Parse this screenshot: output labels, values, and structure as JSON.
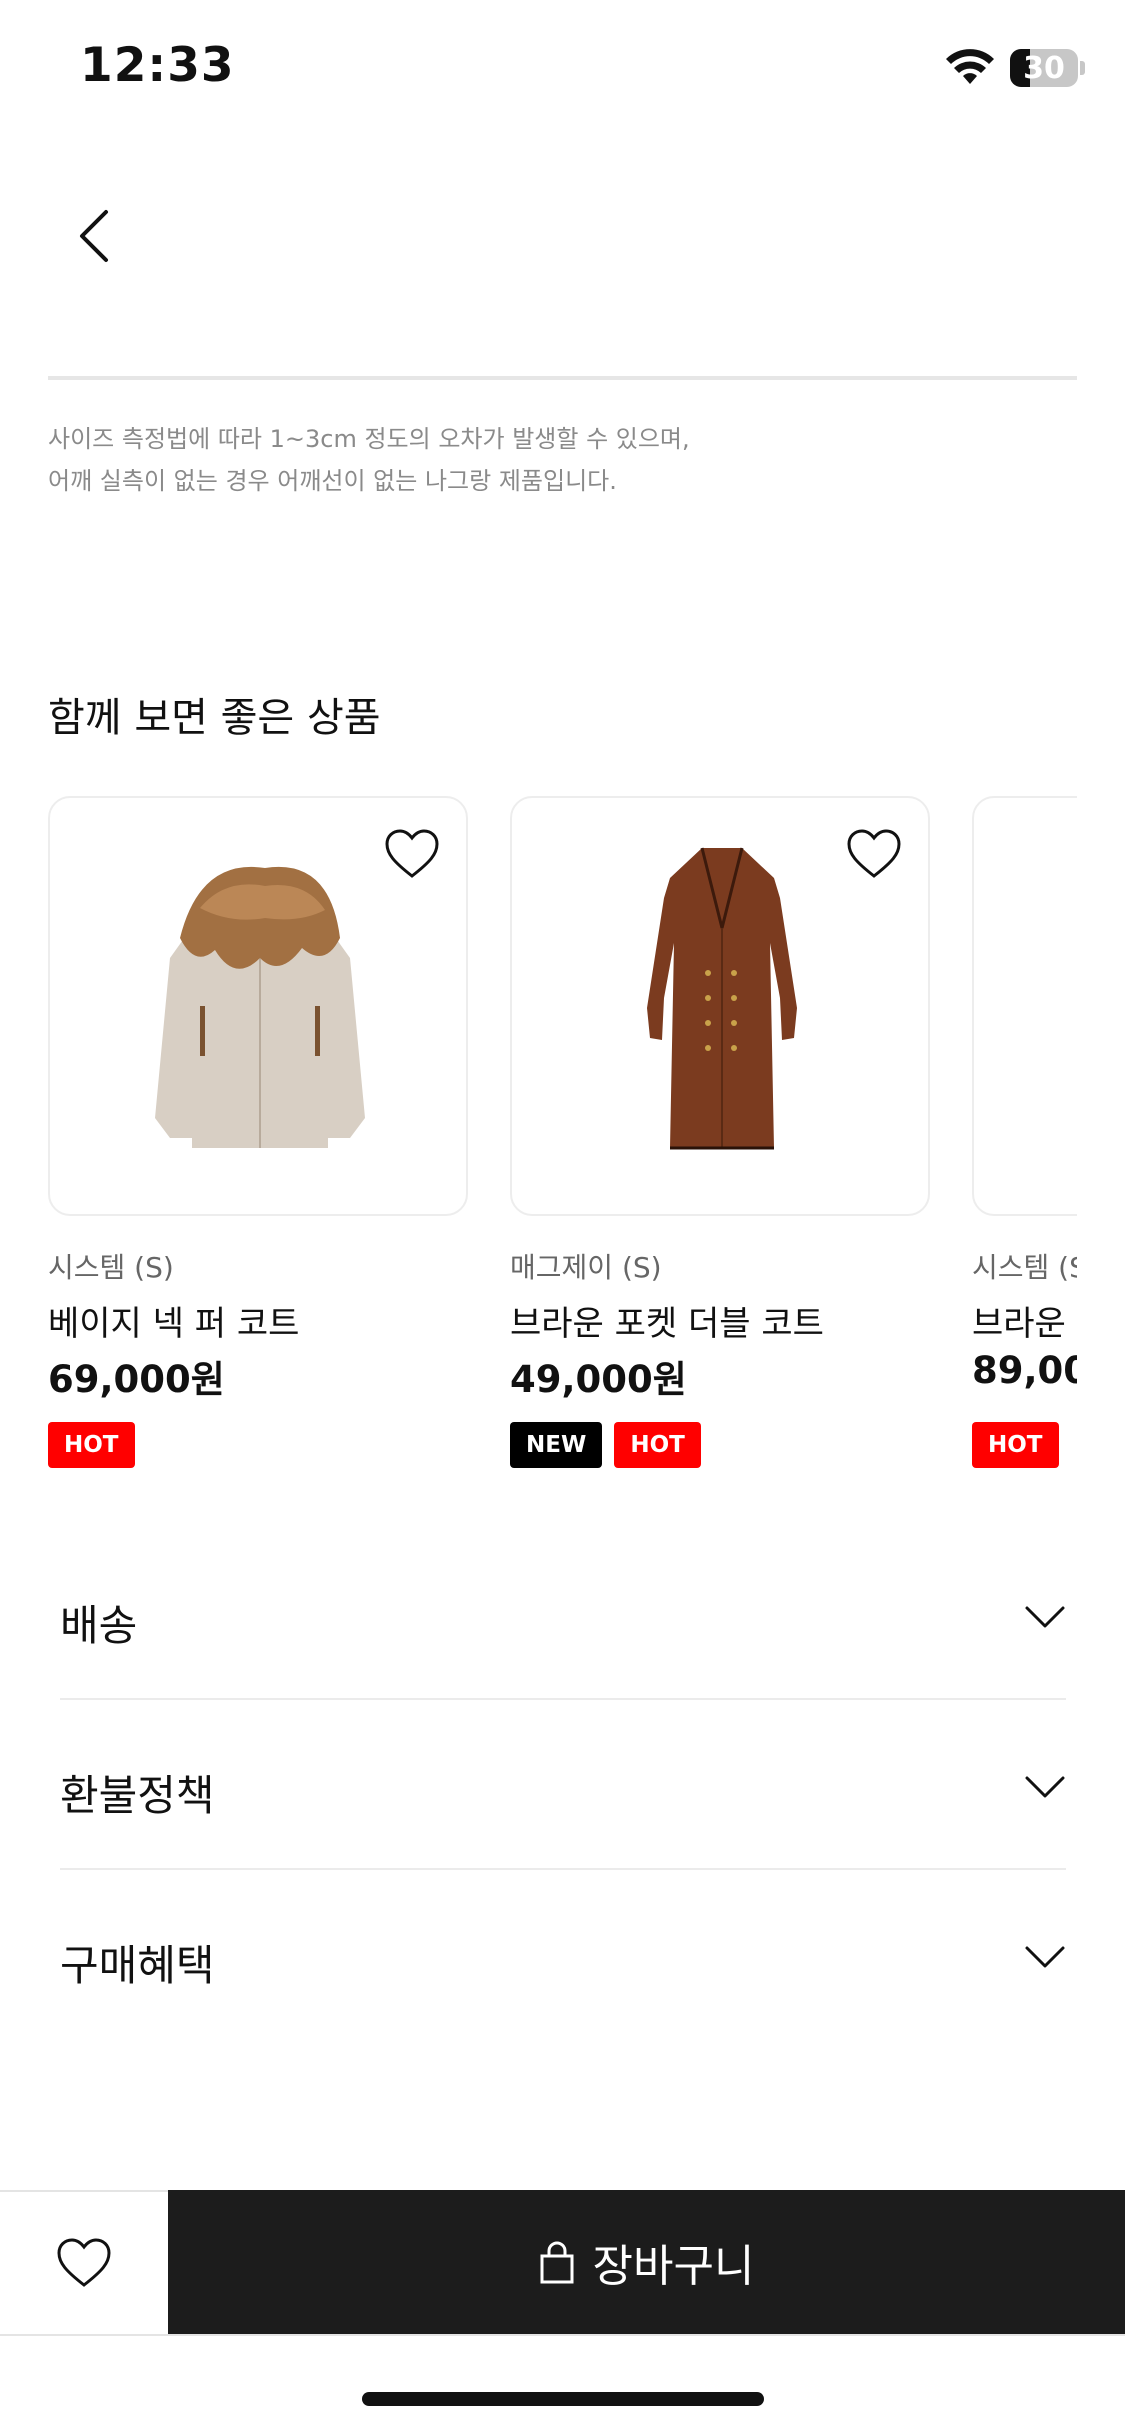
{
  "status_bar": {
    "time": "12:33",
    "battery": "30",
    "battery_level": 0.3
  },
  "notice": {
    "line1": "사이즈 측정법에 따라 1~3cm 정도의 오차가 발생할 수 있으며,",
    "line2": "어깨 실측이 없는 경우 어깨선이 없는 나그랑 제품입니다."
  },
  "recommend": {
    "title": "함께 보면 좋은 상품",
    "products": [
      {
        "brand": "시스템 (S)",
        "name": "베이지 넥 퍼 코트",
        "price": "69,000원",
        "badges": [
          "HOT"
        ],
        "image_icon": "beige-fur-coat-image"
      },
      {
        "brand": "매그제이 (S)",
        "name": "브라운 포켓 더블 코트",
        "price": "49,000원",
        "badges": [
          "NEW",
          "HOT"
        ],
        "image_icon": "brown-double-coat-image"
      },
      {
        "brand": "시스템 (S)",
        "name": "브라운 ",
        "price": "89,00",
        "badges": [
          "HOT"
        ],
        "image_icon": "product-image"
      }
    ]
  },
  "accordion": [
    {
      "label": "배송"
    },
    {
      "label": "환불정책"
    },
    {
      "label": "구매혜택"
    }
  ],
  "bottom_bar": {
    "cart_label": "장바구니",
    "cart_icon": "shopping-bag-icon",
    "wish_icon": "heart-icon"
  },
  "colors": {
    "hot_badge": "#ff0000",
    "new_badge": "#000000",
    "cart_button_bg": "#1c1c1c"
  }
}
